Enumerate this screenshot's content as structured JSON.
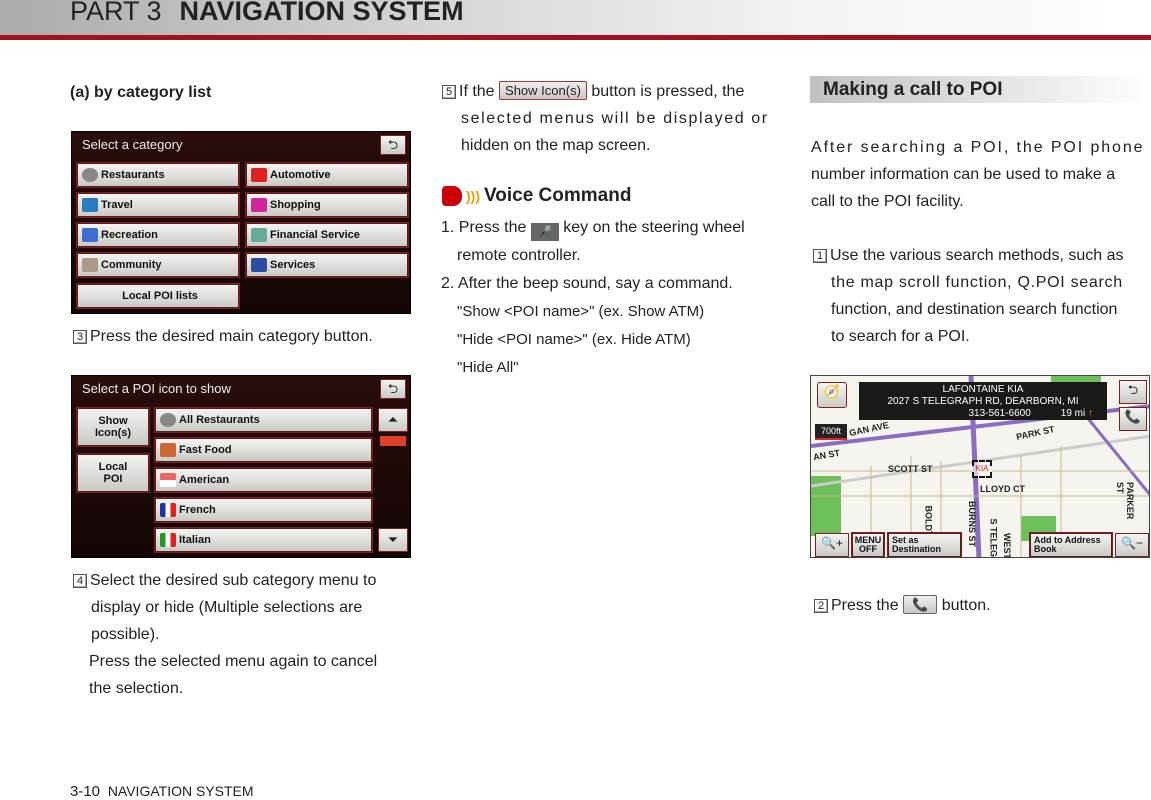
{
  "header": {
    "part": "PART 3",
    "title": "NAVIGATION SYSTEM"
  },
  "footer": {
    "page": "3-10",
    "section": "NAVIGATION SYSTEM"
  },
  "left": {
    "heading": "(a) by category list",
    "screen1": {
      "title": "Select a category",
      "back_icon": "back-arrow-icon",
      "buttons": [
        "Restaurants",
        "Automotive",
        "Travel",
        "Shopping",
        "Recreation",
        "Financial Service",
        "Community",
        "Services",
        "Local POI lists"
      ]
    },
    "step3": {
      "num": "3",
      "text": "Press the desired main category button."
    },
    "screen2": {
      "title": "Select a POI icon to show",
      "show_icons": "Show Icon(s)",
      "local_poi": "Local POI",
      "items": [
        "All Restaurants",
        "Fast Food",
        "American",
        "French",
        "Italian"
      ]
    },
    "step4": {
      "num": "4",
      "lines": [
        "Select the desired sub category menu to",
        "display or hide (Multiple selections are",
        "possible)."
      ],
      "extra": [
        "Press the selected menu again to cancel",
        "the selection."
      ]
    }
  },
  "middle": {
    "step5": {
      "num": "5",
      "pre": "If the",
      "button": "Show Icon(s)",
      "post": "button is pressed, the",
      "lines": [
        "selected menus will be displayed or",
        "hidden on the map screen."
      ]
    },
    "voice": {
      "title": "Voice Command",
      "item1_pre": "1. Press the",
      "item1_post": "key on the steering wheel",
      "item1_cont": "remote controller.",
      "item2": "2. After the beep sound, say a command.",
      "commands": [
        "\"Show <POI name>\"  (ex. Show ATM)",
        "\"Hide <POI name>\"  (ex. Hide ATM)",
        "\"Hide All\""
      ]
    }
  },
  "right": {
    "title": "Making a call to POI",
    "intro": [
      "After searching a POI, the POI phone",
      "number information can be used to make a",
      "call to the POI facility."
    ],
    "step1": {
      "num": "1",
      "lines": [
        "Use the various search methods, such as",
        "the map scroll function, Q.POI search",
        "function, and destination search function",
        "to search for a POI."
      ]
    },
    "map": {
      "name": "LAFONTAINE KIA",
      "address": "2027 S TELEGRAPH RD, DEARBORN, MI",
      "phone": "313-561-6600",
      "distance": "19 mi",
      "scale": "700ft",
      "streets": [
        "GAN AVE",
        "PARK ST",
        "AN ST",
        "SCOTT ST",
        "LLOYD CT",
        "PARKER ST",
        "BOLDT",
        "BURNS ST",
        "S TELEGR",
        "WEST"
      ],
      "buttons": {
        "menu_off": "MENU OFF",
        "set_dest": "Set as Destination",
        "add_book": "Add to Address Book"
      }
    },
    "step2": {
      "num": "2",
      "pre": "Press the",
      "post": "button."
    }
  }
}
